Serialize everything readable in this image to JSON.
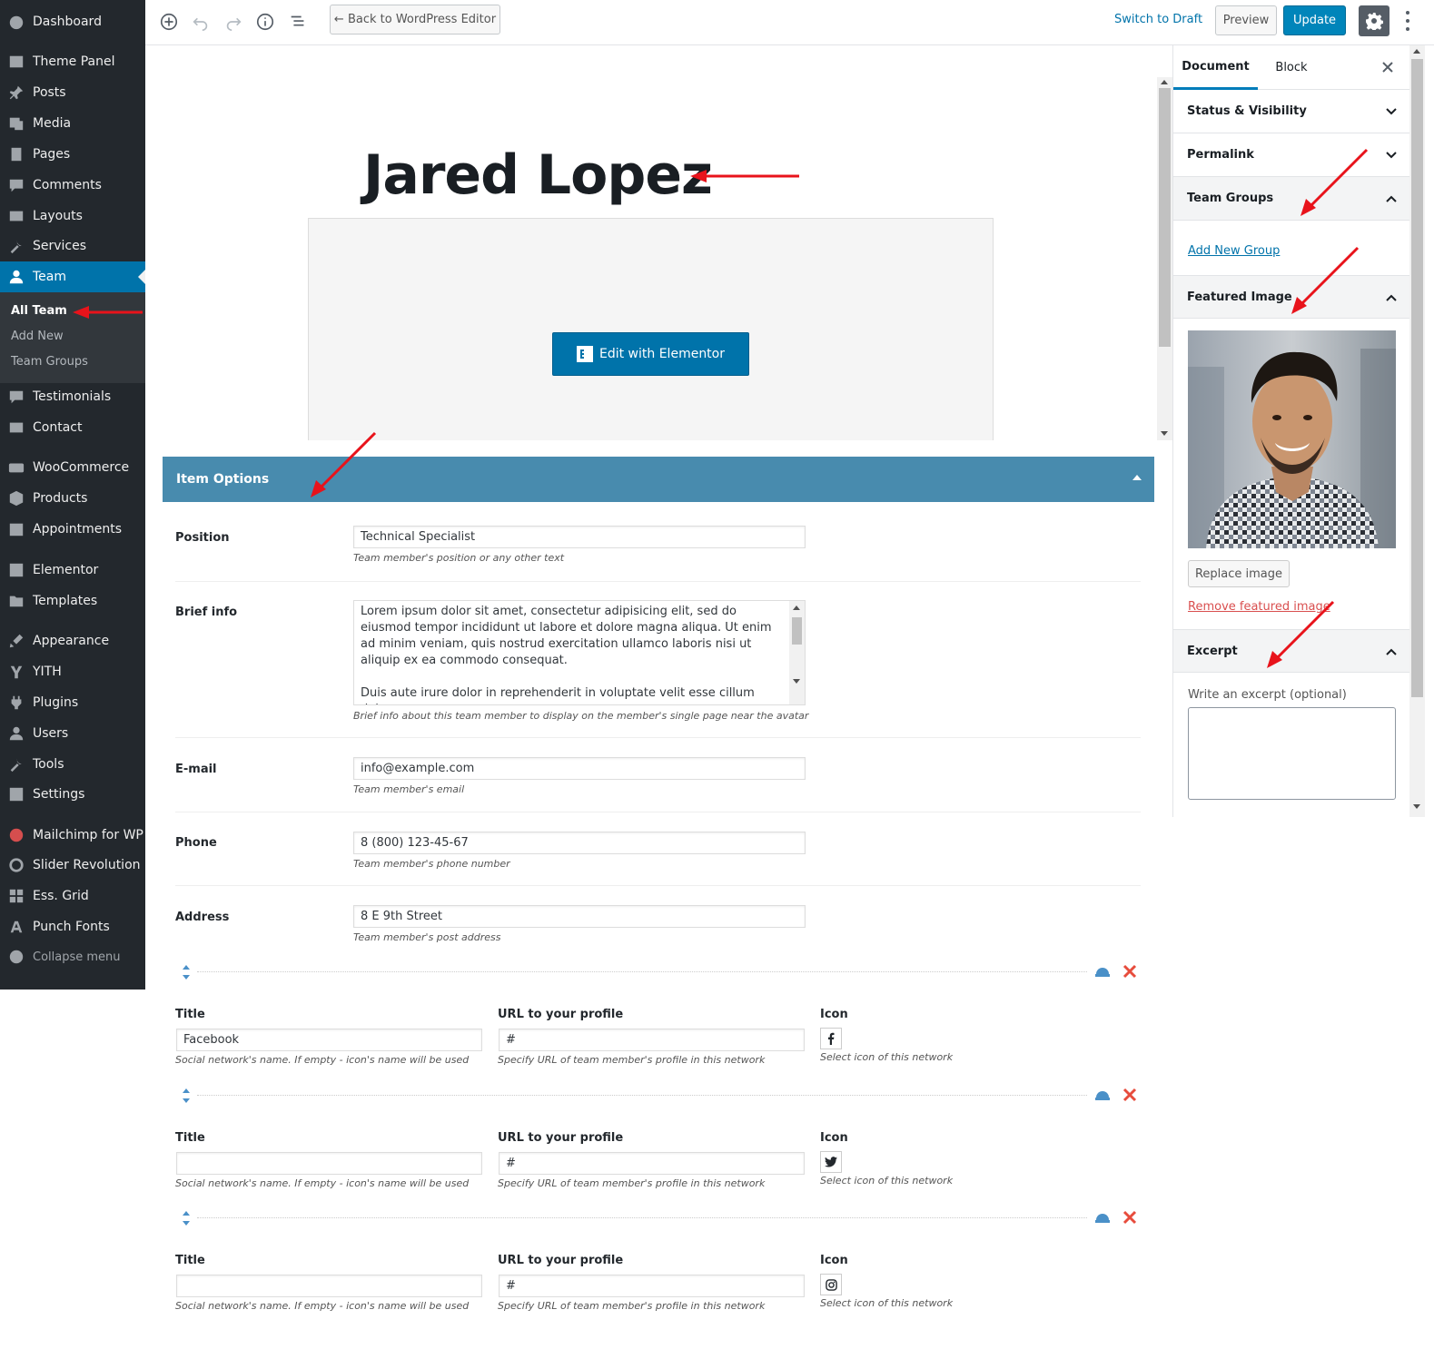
{
  "sidebar": {
    "items": [
      {
        "label": "Dashboard",
        "icon": "dashboard-icon"
      },
      {
        "label": "Theme Panel",
        "icon": "theme-panel-icon"
      },
      {
        "label": "Posts",
        "icon": "pin-icon"
      },
      {
        "label": "Media",
        "icon": "media-icon"
      },
      {
        "label": "Pages",
        "icon": "pages-icon"
      },
      {
        "label": "Comments",
        "icon": "comments-icon"
      },
      {
        "label": "Layouts",
        "icon": "layouts-icon"
      },
      {
        "label": "Services",
        "icon": "wrench-icon"
      },
      {
        "label": "Team",
        "icon": "user-icon"
      },
      {
        "label": "Testimonials",
        "icon": "testimonials-icon"
      },
      {
        "label": "Contact",
        "icon": "mail-icon"
      },
      {
        "label": "WooCommerce",
        "icon": "woocommerce-icon"
      },
      {
        "label": "Products",
        "icon": "products-icon"
      },
      {
        "label": "Appointments",
        "icon": "calendar-icon"
      },
      {
        "label": "Elementor",
        "icon": "elementor-icon"
      },
      {
        "label": "Templates",
        "icon": "folder-icon"
      },
      {
        "label": "Appearance",
        "icon": "brush-icon"
      },
      {
        "label": "YITH",
        "icon": "yith-icon"
      },
      {
        "label": "Plugins",
        "icon": "plugin-icon"
      },
      {
        "label": "Users",
        "icon": "users-icon"
      },
      {
        "label": "Tools",
        "icon": "tools-icon"
      },
      {
        "label": "Settings",
        "icon": "settings-icon"
      },
      {
        "label": "Mailchimp for WP",
        "icon": "mailchimp-icon"
      },
      {
        "label": "Slider Revolution",
        "icon": "refresh-icon"
      },
      {
        "label": "Ess. Grid",
        "icon": "grid-icon"
      },
      {
        "label": "Punch Fonts",
        "icon": "font-icon"
      },
      {
        "label": "Collapse menu",
        "icon": "collapse-icon"
      }
    ],
    "submenu": [
      "All Team",
      "Add New",
      "Team Groups"
    ]
  },
  "toolbar": {
    "back_label": "← Back to WordPress Editor",
    "switch_draft": "Switch to Draft",
    "preview": "Preview",
    "update": "Update"
  },
  "editor": {
    "title": "Jared Lopez",
    "elementor_button": "Edit with Elementor"
  },
  "metabox": {
    "title": "Item Options",
    "fields": {
      "position": {
        "label": "Position",
        "value": "Technical Specialist",
        "desc": "Team member's position or any other text"
      },
      "brief": {
        "label": "Brief info",
        "p1": "Lorem ipsum dolor sit amet, consectetur adipisicing elit, sed do eiusmod tempor incididunt ut labore et dolore magna aliqua. Ut enim ad minim veniam, quis nostrud exercitation ullamco laboris nisi ut aliquip ex ea commodo consequat.",
        "p2": "Duis aute irure dolor in reprehenderit in voluptate velit esse cillum dolore eu",
        "desc": "Brief info about this team member to display on the member's single page near the avatar"
      },
      "email": {
        "label": "E-mail",
        "value": "info@example.com",
        "desc": "Team member's email"
      },
      "phone": {
        "label": "Phone",
        "value": "8 (800) 123-45-67",
        "desc": "Team member's phone number"
      },
      "address": {
        "label": "Address",
        "value": "8 E 9th Street",
        "desc": "Team member's post address"
      }
    },
    "social": {
      "title_label": "Title",
      "url_label": "URL to your profile",
      "icon_label": "Icon",
      "title_desc": "Social network's name. If empty - icon's name will be used",
      "url_desc": "Specify URL of team member's profile in this network",
      "icon_desc": "Select icon of this network",
      "rows": [
        {
          "title": "Facebook",
          "url": "#",
          "icon": "facebook-icon"
        },
        {
          "title": "",
          "url": "#",
          "icon": "twitter-icon"
        },
        {
          "title": "",
          "url": "#",
          "icon": "instagram-icon"
        }
      ]
    }
  },
  "panel": {
    "tab_document": "Document",
    "tab_block": "Block",
    "sections": {
      "status": "Status & Visibility",
      "permalink": "Permalink",
      "team_groups": "Team Groups",
      "featured_image": "Featured Image",
      "excerpt": "Excerpt"
    },
    "add_new_group": "Add New Group",
    "replace_image": "Replace image",
    "remove_image": "Remove featured image",
    "excerpt_placeholder": "Write an excerpt (optional)"
  },
  "colors": {
    "sidebar_bg": "#23282d",
    "active_menu": "#0073aa",
    "metabox_head": "#488bae",
    "update_btn": "#0085ba",
    "annotation_arrow": "#e8131b",
    "delete_red": "#e74c3c"
  }
}
